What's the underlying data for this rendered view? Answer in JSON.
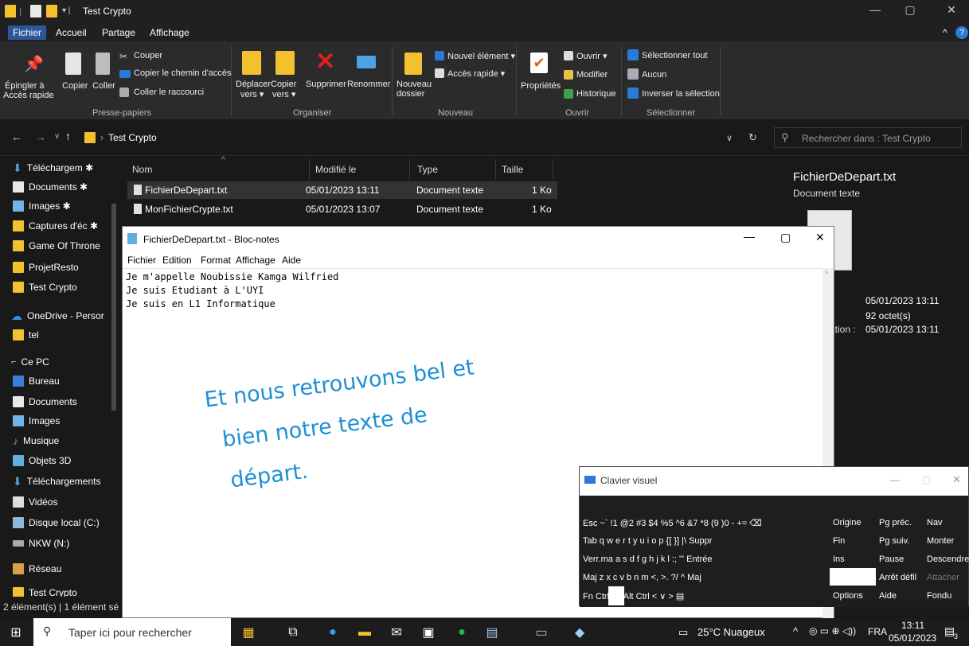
{
  "window": {
    "title": "Test Crypto",
    "minimize": "—",
    "maximize": "▢",
    "close": "✕"
  },
  "menu": {
    "tabs": [
      "Fichier",
      "Accueil",
      "Partage",
      "Affichage"
    ],
    "expand": "^"
  },
  "ribbon": {
    "epingler": [
      "Épingler à",
      "Accès rapide"
    ],
    "copier": "Copier",
    "coller": "Coller",
    "couper": "Couper",
    "copier_chemin": "Copier le chemin d'accès",
    "coller_raccourci": "Coller le raccourci",
    "presse_papiers": "Presse-papiers",
    "deplacer": [
      "Déplacer",
      "vers ▾"
    ],
    "copier_vers": [
      "Copier",
      "vers ▾"
    ],
    "supprimer": "Supprimer",
    "renommer": "Renommer",
    "organiser": "Organiser",
    "nouveau_dossier": [
      "Nouveau",
      "dossier"
    ],
    "nouvel_element": "Nouvel élément ▾",
    "acces_rapide": "Accès rapide ▾",
    "nouveau": "Nouveau",
    "proprietes": "Propriétés",
    "ouvrir_btn": "Ouvrir ▾",
    "modifier": "Modifier",
    "historique": "Historique",
    "ouvrir": "Ouvrir",
    "selectionner_tout": "Sélectionner tout",
    "aucun": "Aucun",
    "inverser": "Inverser la sélection",
    "selectionner": "Sélectionner"
  },
  "address": {
    "path": "Test Crypto",
    "search_placeholder": "Rechercher dans : Test Crypto"
  },
  "nav": {
    "items": [
      "Téléchargem ✱",
      "Documents  ✱",
      "Images  ✱",
      "Captures d'éc ✱",
      "Game Of Throne",
      "ProjetResto",
      "Test Crypto",
      "OneDrive - Persor",
      "tel",
      "Ce PC",
      "Bureau",
      "Documents",
      "Images",
      "Musique",
      "Objets 3D",
      "Téléchargements",
      "Vidéos",
      "Disque local (C:)",
      "NKW (N:)",
      "Réseau",
      "Test Crypto"
    ]
  },
  "files": {
    "headers": [
      "Nom",
      "Modifié le",
      "Type",
      "Taille"
    ],
    "rows": [
      {
        "name": "FichierDeDepart.txt",
        "modified": "05/01/2023 13:11",
        "type": "Document texte",
        "size": "1 Ko"
      },
      {
        "name": "MonFichierCrypte.txt",
        "modified": "05/01/2023 13:07",
        "type": "Document texte",
        "size": "1 Ko"
      }
    ]
  },
  "preview": {
    "filename": "FichierDeDepart.txt",
    "type": "Document texte",
    "modified": "05/01/2023 13:11",
    "size": "92 octet(s)",
    "created_label": "ation :",
    "created": "05/01/2023 13:11"
  },
  "status": {
    "text": "2 élément(s)  |  1 élément sé"
  },
  "notepad": {
    "title": "FichierDeDepart.txt - Bloc-notes",
    "menu": [
      "Fichier",
      "Edition",
      "Format",
      "Affichage",
      "Aide"
    ],
    "lines": [
      "Je m'appelle Noubissie Kamga Wilfried",
      "Je suis Etudiant à L'UYI",
      "Je suis en L1 Informatique"
    ]
  },
  "overlay": {
    "lines": [
      "Et nous retrouvons bel et",
      "bien notre texte de",
      "départ."
    ]
  },
  "osk": {
    "title": "Clavier visuel",
    "row1": "Esc  ~`  !1  @2  #3  $4  %5  ^6  &7  *8  (9  )0  -  +=  ⌫",
    "row2": "Tab  q  w  e  r  t  y  u  i  o  p  {[  }]  |\\  Suppr",
    "row3": "Verr.ma  a  s  d  f  g  h  j  k  l  :;  \"'  Entrée",
    "row4": "Maj   z  x  c  v  b  n  m  <,  >.  ?/  ^  Maj",
    "row5": "Fn  Ctrl        Alt                                  Alt  Ctrl  <  ∨  >  ▤",
    "right": [
      [
        "Origine",
        "Pg préc.",
        "Nav"
      ],
      [
        "Fin",
        "Pg suiv.",
        "Monter"
      ],
      [
        "Ins",
        "Pause",
        "Descendre"
      ],
      [
        "",
        "Arrêt défil",
        "Attacher"
      ],
      [
        "Options",
        "Aide",
        "Fondu"
      ]
    ]
  },
  "taskbar": {
    "search_placeholder": "Taper ici pour rechercher",
    "weather": "25°C  Nuageux",
    "lang": "FRA",
    "time": "13:11",
    "date": "05/01/2023",
    "notif": "3"
  },
  "colors": {
    "folder": "#f2c12e",
    "accent_blue": "#2b579a",
    "overlay_text": "#1f8fd6"
  }
}
